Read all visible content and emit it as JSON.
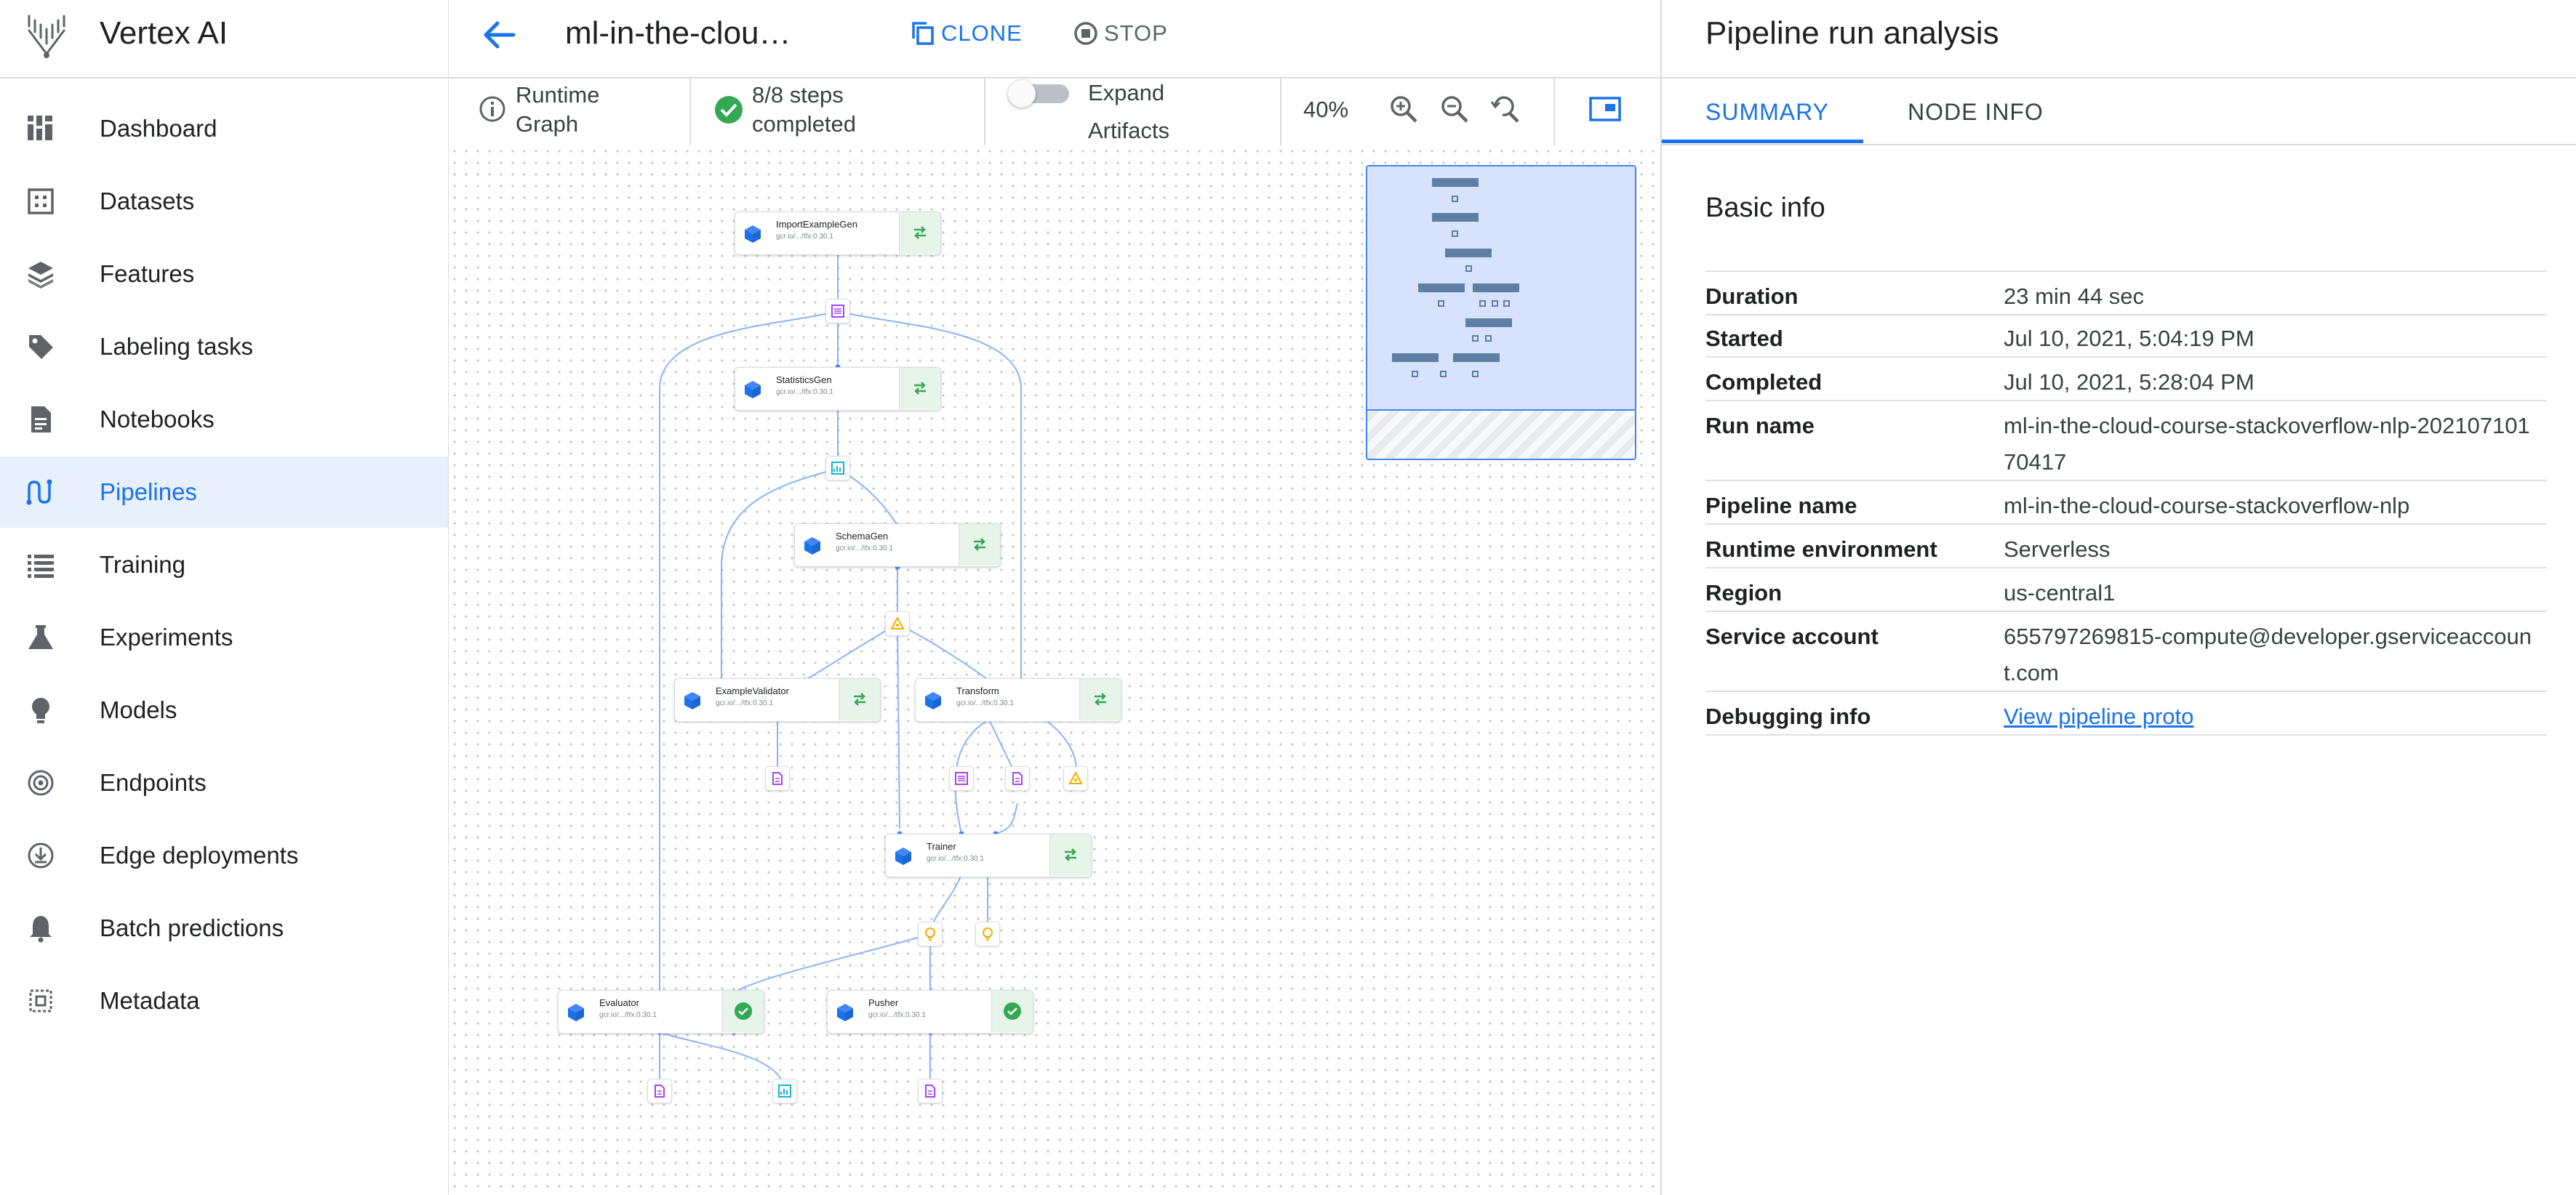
{
  "app": {
    "name": "Vertex AI",
    "logo_icon": "vertex-ai-logo"
  },
  "sidebar": {
    "items": [
      {
        "label": "Dashboard",
        "icon": "dashboard-icon",
        "active": false
      },
      {
        "label": "Datasets",
        "icon": "datasets-icon",
        "active": false
      },
      {
        "label": "Features",
        "icon": "features-icon",
        "active": false
      },
      {
        "label": "Labeling tasks",
        "icon": "label-icon",
        "active": false
      },
      {
        "label": "Notebooks",
        "icon": "notebook-icon",
        "active": false
      },
      {
        "label": "Pipelines",
        "icon": "pipelines-icon",
        "active": true
      },
      {
        "label": "Training",
        "icon": "training-list-icon",
        "active": false
      },
      {
        "label": "Experiments",
        "icon": "flask-icon",
        "active": false
      },
      {
        "label": "Models",
        "icon": "lightbulb-icon",
        "active": false
      },
      {
        "label": "Endpoints",
        "icon": "endpoints-icon",
        "active": false
      },
      {
        "label": "Edge deployments",
        "icon": "download-circle-icon",
        "active": false
      },
      {
        "label": "Batch predictions",
        "icon": "bell-icon",
        "active": false
      },
      {
        "label": "Metadata",
        "icon": "metadata-icon",
        "active": false
      }
    ]
  },
  "header": {
    "run_title": "ml-in-the-clou…",
    "clone_label": "CLONE",
    "stop_label": "STOP"
  },
  "toolbar": {
    "runtime_graph_line1": "Runtime",
    "runtime_graph_line2": "Graph",
    "steps_line1": "8/8 steps",
    "steps_line2": "completed",
    "expand_line1": "Expand",
    "expand_line2": "Artifacts",
    "expand_on": false,
    "zoom": "40%"
  },
  "graph": {
    "nodes": [
      {
        "name": "ImportExampleGen",
        "sub": "gcr.io/.../tfx:0.30.1",
        "status": "cached"
      },
      {
        "name": "StatisticsGen",
        "sub": "gcr.io/.../tfx:0.30.1",
        "status": "cached"
      },
      {
        "name": "SchemaGen",
        "sub": "gcr.io/.../tfx:0.30.1",
        "status": "cached"
      },
      {
        "name": "ExampleValidator",
        "sub": "gcr.io/.../tfx:0.30.1",
        "status": "cached"
      },
      {
        "name": "Transform",
        "sub": "gcr.io/.../tfx:0.30.1",
        "status": "cached"
      },
      {
        "name": "Trainer",
        "sub": "gcr.io/.../tfx:0.30.1",
        "status": "cached"
      },
      {
        "name": "Evaluator",
        "sub": "gcr.io/.../tfx:0.30.1",
        "status": "succeeded"
      },
      {
        "name": "Pusher",
        "sub": "gcr.io/.../tfx:0.30.1",
        "status": "succeeded"
      }
    ],
    "colors": {
      "edge": "#8ab4f8",
      "node_icon": "#1a73e8",
      "success": "#34a853",
      "artifact_purple": "#a142f4",
      "artifact_teal": "#12b5cb",
      "artifact_yellow": "#f9ab00"
    }
  },
  "panel": {
    "title": "Pipeline run analysis",
    "tabs": [
      "SUMMARY",
      "NODE INFO"
    ],
    "active_tab": "SUMMARY",
    "section_title": "Basic info",
    "rows": [
      {
        "key": "Duration",
        "value": "23 min 44 sec"
      },
      {
        "key": "Started",
        "value": "Jul 10, 2021, 5:04:19 PM"
      },
      {
        "key": "Completed",
        "value": "Jul 10, 2021, 5:28:04 PM"
      },
      {
        "key": "Run name",
        "value": "ml-in-the-cloud-course-stackoverflow-nlp-20210710170417"
      },
      {
        "key": "Pipeline name",
        "value": "ml-in-the-cloud-course-stackoverflow-nlp"
      },
      {
        "key": "Runtime environment",
        "value": "Serverless"
      },
      {
        "key": "Region",
        "value": "us-central1"
      },
      {
        "key": "Service account",
        "value": "655797269815-compute@developer.gserviceaccount.com"
      },
      {
        "key": "Debugging info",
        "value": "View pipeline proto"
      }
    ]
  }
}
